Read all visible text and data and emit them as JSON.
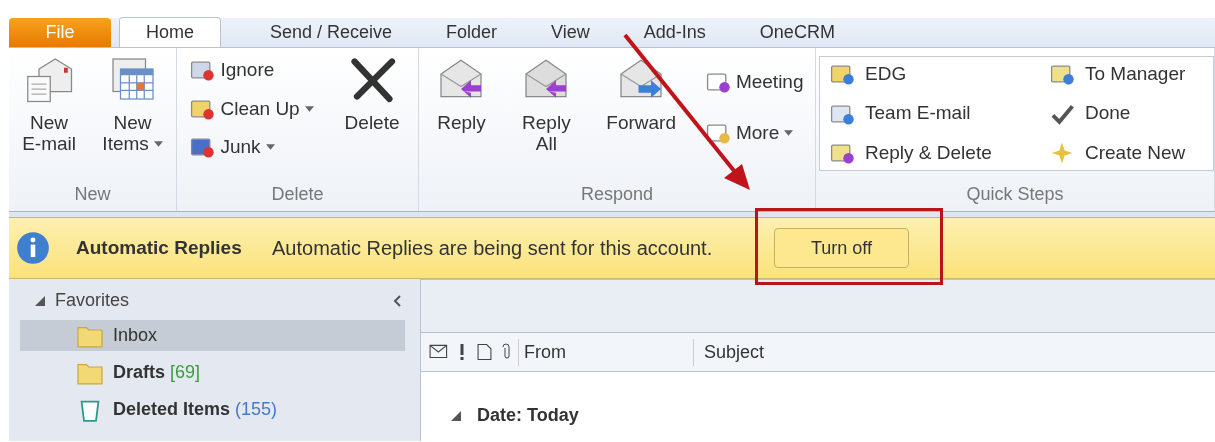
{
  "tabs": [
    {
      "label": "File",
      "kind": "backstage",
      "selected": false
    },
    {
      "label": "Home",
      "kind": "tab",
      "selected": true
    },
    {
      "label": "Send / Receive",
      "kind": "tab",
      "selected": false
    },
    {
      "label": "Folder",
      "kind": "tab",
      "selected": false
    },
    {
      "label": "View",
      "kind": "tab",
      "selected": false
    },
    {
      "label": "Add-Ins",
      "kind": "tab",
      "selected": false
    },
    {
      "label": "OneCRM",
      "kind": "tab",
      "selected": false
    }
  ],
  "ribbon": {
    "groups": [
      {
        "label": "New",
        "items": [
          {
            "kind": "large",
            "lines": [
              "New",
              "E-mail"
            ],
            "dropdown": false
          },
          {
            "kind": "large",
            "lines": [
              "New",
              "Items"
            ],
            "dropdown": true
          }
        ]
      },
      {
        "label": "Delete",
        "items": [
          {
            "kind": "stack",
            "items": [
              {
                "label": "Ignore",
                "dropdown": false
              },
              {
                "label": "Clean Up",
                "dropdown": true
              },
              {
                "label": "Junk",
                "dropdown": true
              }
            ]
          },
          {
            "kind": "large",
            "lines": [
              "Delete"
            ],
            "dropdown": false
          }
        ]
      },
      {
        "label": "Respond",
        "items": [
          {
            "kind": "large",
            "lines": [
              "Reply"
            ],
            "dropdown": false
          },
          {
            "kind": "large",
            "lines": [
              "Reply",
              "All"
            ],
            "dropdown": false
          },
          {
            "kind": "large",
            "lines": [
              "Forward"
            ],
            "dropdown": false
          },
          {
            "kind": "stack",
            "items": [
              {
                "label": "Meeting",
                "dropdown": false
              },
              {
                "label": "More",
                "dropdown": true
              }
            ]
          }
        ]
      },
      {
        "label": "Quick Steps",
        "items": [
          {
            "kind": "gallery",
            "items": [
              {
                "label": "EDG"
              },
              {
                "label": "To Manager"
              },
              {
                "label": "Team E-mail"
              },
              {
                "label": "Done"
              },
              {
                "label": "Reply & Delete"
              },
              {
                "label": "Create New"
              }
            ]
          }
        ]
      }
    ]
  },
  "info_bar": {
    "title": "Automatic Replies",
    "message": "Automatic Replies are being sent for this account.",
    "button": "Turn off"
  },
  "sidebar": {
    "sections": [
      {
        "label": "Favorites",
        "expanded": true,
        "items": [
          {
            "label": "Inbox",
            "selected": true
          },
          {
            "label": "Drafts",
            "count": "[69]",
            "color": "#3c9a3c",
            "selected": false
          },
          {
            "label": "Deleted Items",
            "count": "(155)",
            "color": "#4a78c8",
            "selected": false
          }
        ]
      }
    ]
  },
  "mail_list": {
    "columns": [
      "From",
      "Subject"
    ],
    "groups": [
      {
        "label": "Date: Today",
        "expanded": true
      }
    ]
  }
}
